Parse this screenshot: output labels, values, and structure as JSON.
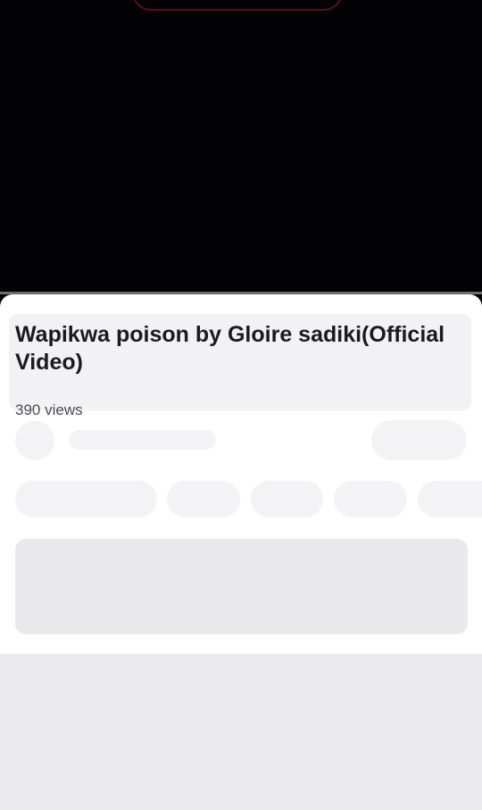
{
  "video": {
    "title": "Wapikwa poison by Gloire sadiki(Official Video)",
    "views": "390 views"
  },
  "colors": {
    "player_background": "#030305",
    "sheet_background": "#ffffff",
    "skeleton": "#f3f2f5",
    "title_text": "#1b1b1f"
  }
}
